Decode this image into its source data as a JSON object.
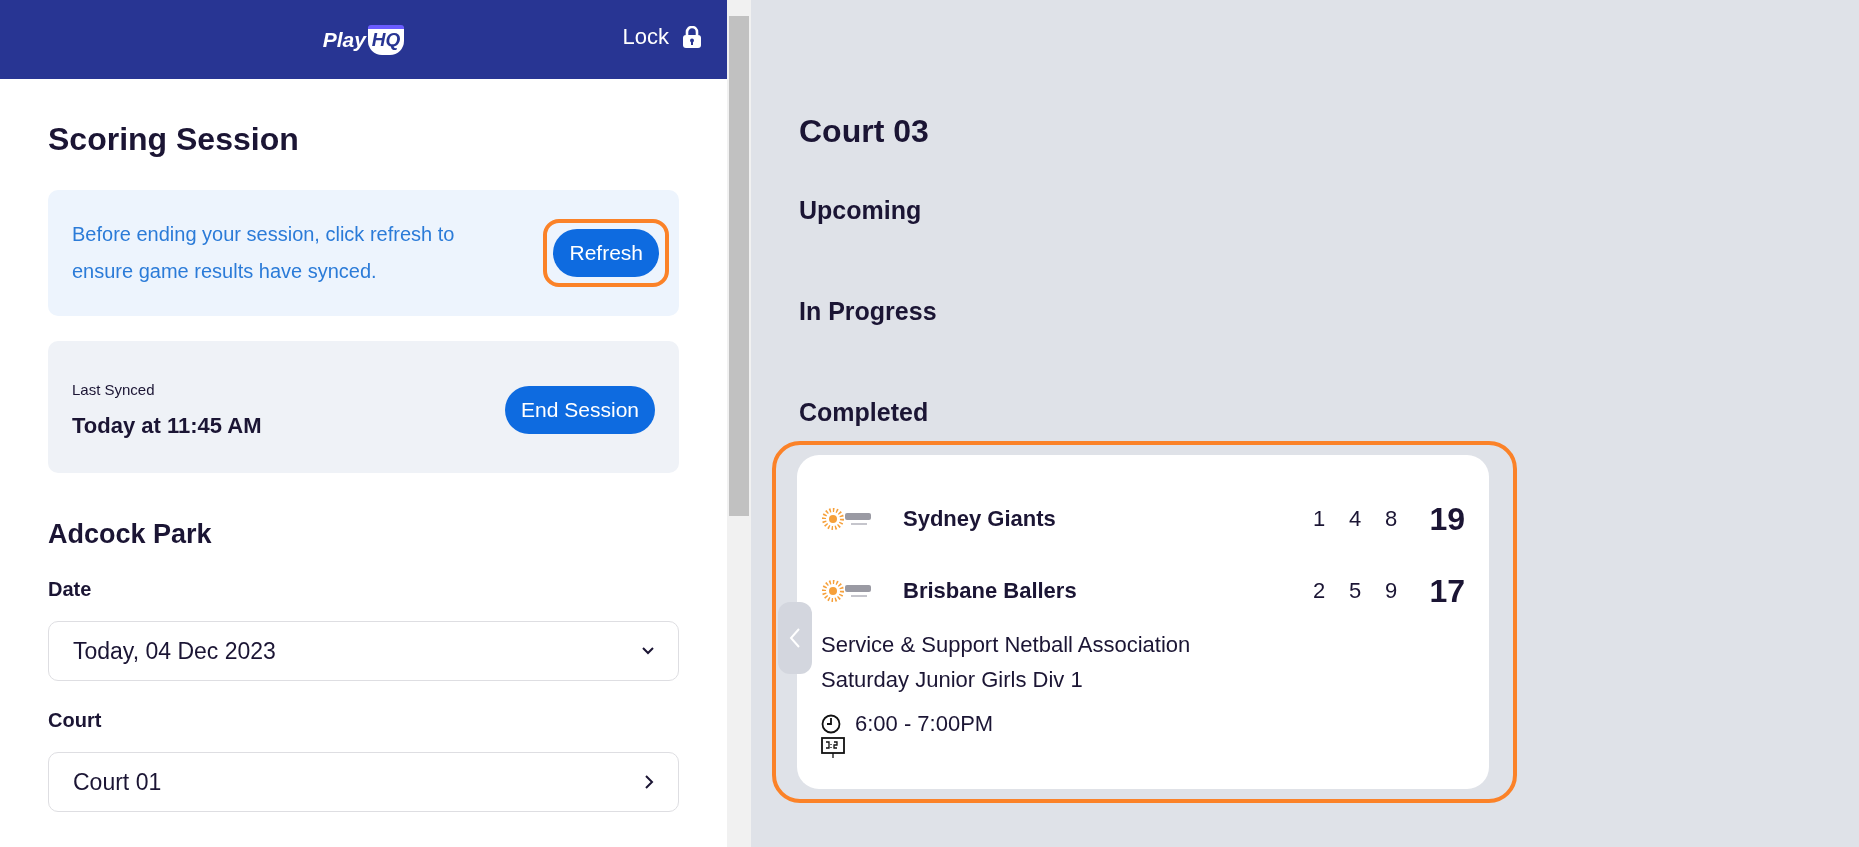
{
  "header": {
    "logo_play": "Play",
    "logo_hq": "HQ",
    "lock_label": "Lock"
  },
  "session": {
    "title": "Scoring Session",
    "notice": {
      "text": "Before ending your session, click refresh to ensure game results have synced.",
      "button": "Refresh",
      "highlighted": true
    },
    "sync": {
      "label": "Last Synced",
      "time": "Today at 11:45 AM",
      "button": "End Session"
    }
  },
  "venue": {
    "title": "Adcock Park",
    "fields": [
      {
        "label": "Date",
        "value": "Today, 04 Dec 2023",
        "kind": "dropdown"
      },
      {
        "label": "Court",
        "value": "Court 01",
        "kind": "link"
      }
    ]
  },
  "court": {
    "title": "Court 03",
    "sections": [
      {
        "title": "Upcoming"
      },
      {
        "title": "In Progress"
      },
      {
        "title": "Completed",
        "games": [
          {
            "highlighted": true,
            "teams": [
              {
                "name": "Sydney Giants",
                "quarters": [
                  "1",
                  "4",
                  "8"
                ],
                "total": "19"
              },
              {
                "name": "Brisbane Ballers",
                "quarters": [
                  "2",
                  "5",
                  "9"
                ],
                "total": "17"
              }
            ],
            "association": "Service & Support Netball Association",
            "competition": "Saturday Junior Girls Div 1",
            "time": "6:00 - 7:00PM"
          }
        ]
      }
    ]
  }
}
